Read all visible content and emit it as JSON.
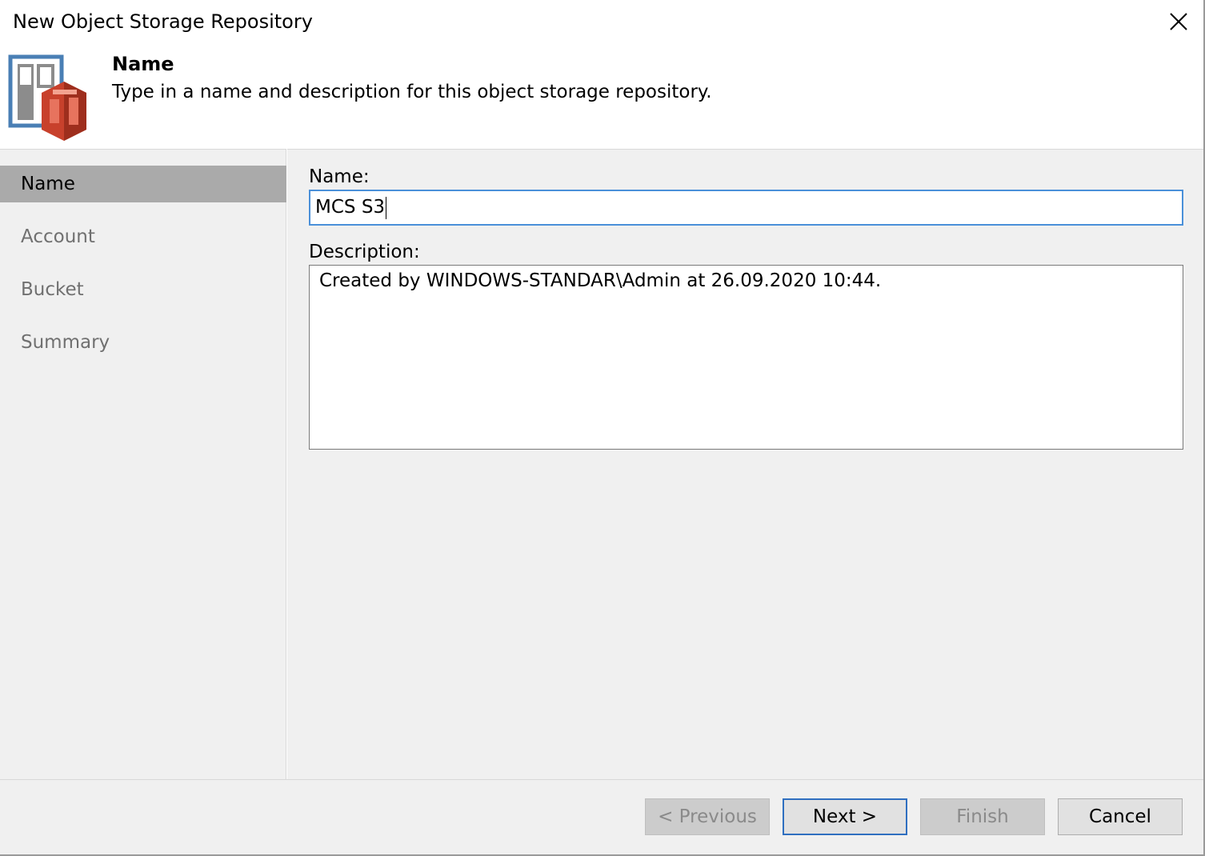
{
  "window": {
    "title": "New Object Storage Repository"
  },
  "header": {
    "title": "Name",
    "subtitle": "Type in a name and description for this object storage repository.",
    "icon": "object-storage-repository-icon"
  },
  "steps": [
    {
      "label": "Name",
      "active": true
    },
    {
      "label": "Account",
      "active": false
    },
    {
      "label": "Bucket",
      "active": false
    },
    {
      "label": "Summary",
      "active": false
    }
  ],
  "form": {
    "name_label": "Name:",
    "name_value": "MCS S3",
    "description_label": "Description:",
    "description_value": "Created by WINDOWS-STANDAR\\Admin at 26.09.2020 10:44."
  },
  "buttons": {
    "previous": "< Previous",
    "next": "Next >",
    "finish": "Finish",
    "cancel": "Cancel"
  },
  "colors": {
    "accent": "#2f6fc0",
    "active_step": "#aaaaaa",
    "panel_bg": "#f0f0f0",
    "icon_blue": "#4a7fb5",
    "icon_red": "#c8412c"
  }
}
